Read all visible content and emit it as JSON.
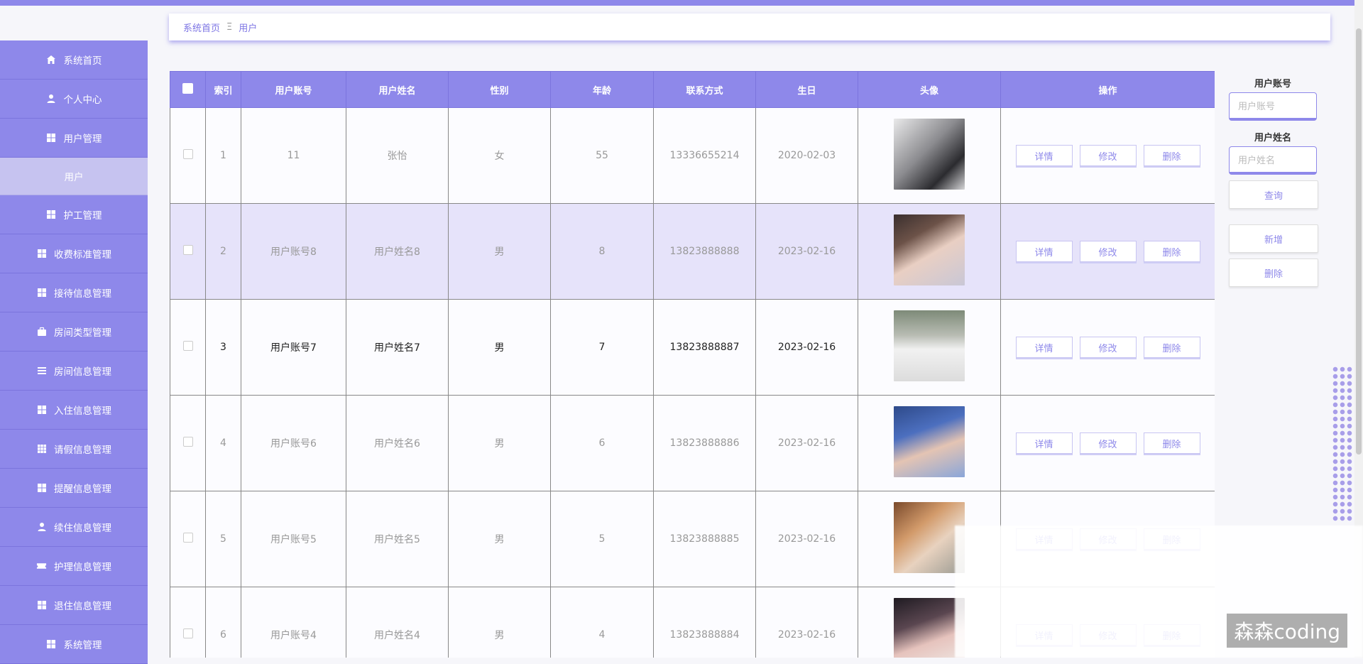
{
  "breadcrumb": {
    "home": "系统首页",
    "sep": "Ξ",
    "current": "用户"
  },
  "sidebar": {
    "items": [
      {
        "label": "系统首页",
        "icon": "home-icon"
      },
      {
        "label": "个人中心",
        "icon": "user-icon"
      },
      {
        "label": "用户管理",
        "icon": "grid-icon"
      },
      {
        "label": "用户",
        "icon": "",
        "sub": true
      },
      {
        "label": "护工管理",
        "icon": "grid-icon"
      },
      {
        "label": "收费标准管理",
        "icon": "grid-icon"
      },
      {
        "label": "接待信息管理",
        "icon": "grid-icon"
      },
      {
        "label": "房间类型管理",
        "icon": "briefcase-icon"
      },
      {
        "label": "房间信息管理",
        "icon": "list-icon"
      },
      {
        "label": "入住信息管理",
        "icon": "grid-icon"
      },
      {
        "label": "请假信息管理",
        "icon": "table-icon"
      },
      {
        "label": "提醒信息管理",
        "icon": "grid-icon"
      },
      {
        "label": "续住信息管理",
        "icon": "user-icon"
      },
      {
        "label": "护理信息管理",
        "icon": "ticket-icon"
      },
      {
        "label": "退住信息管理",
        "icon": "grid-icon"
      },
      {
        "label": "系统管理",
        "icon": "grid-icon"
      }
    ]
  },
  "table": {
    "headers": [
      "索引",
      "用户账号",
      "用户姓名",
      "性别",
      "年龄",
      "联系方式",
      "生日",
      "头像",
      "操作"
    ],
    "rows": [
      {
        "index": "1",
        "account": "11",
        "name": "张怡",
        "gender": "女",
        "age": "55",
        "phone": "13336655214",
        "birthday": "2020-02-03"
      },
      {
        "index": "2",
        "account": "用户账号8",
        "name": "用户姓名8",
        "gender": "男",
        "age": "8",
        "phone": "13823888888",
        "birthday": "2023-02-16"
      },
      {
        "index": "3",
        "account": "用户账号7",
        "name": "用户姓名7",
        "gender": "男",
        "age": "7",
        "phone": "13823888887",
        "birthday": "2023-02-16"
      },
      {
        "index": "4",
        "account": "用户账号6",
        "name": "用户姓名6",
        "gender": "男",
        "age": "6",
        "phone": "13823888886",
        "birthday": "2023-02-16"
      },
      {
        "index": "5",
        "account": "用户账号5",
        "name": "用户姓名5",
        "gender": "男",
        "age": "5",
        "phone": "13823888885",
        "birthday": "2023-02-16"
      },
      {
        "index": "6",
        "account": "用户账号4",
        "name": "用户姓名4",
        "gender": "男",
        "age": "4",
        "phone": "13823888884",
        "birthday": "2023-02-16"
      }
    ],
    "actions": {
      "detail": "详情",
      "edit": "修改",
      "delete": "删除"
    }
  },
  "search": {
    "account_label": "用户账号",
    "account_placeholder": "用户账号",
    "name_label": "用户姓名",
    "name_placeholder": "用户姓名",
    "query": "查询",
    "add": "新增",
    "delete": "删除"
  },
  "watermark": "森森coding"
}
